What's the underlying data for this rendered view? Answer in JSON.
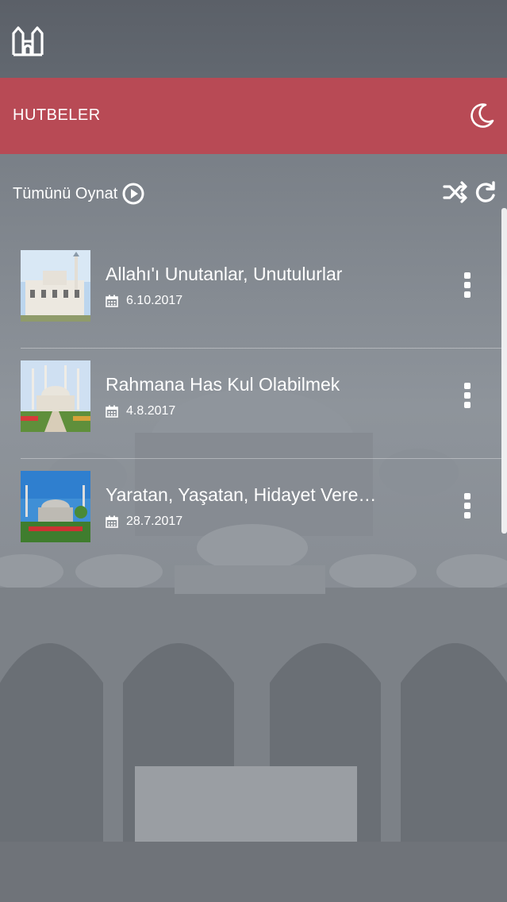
{
  "header": {
    "title": "HUTBELER"
  },
  "controls": {
    "play_all_label": "Tümünü Oynat"
  },
  "sermons": [
    {
      "title": "Allahı'ı Unutanlar, Unutulurlar",
      "date": "6.10.2017"
    },
    {
      "title": "Rahmana Has Kul Olabilmek",
      "date": "4.8.2017"
    },
    {
      "title": "Yaratan, Yaşatan, Hidayet Veren Allah",
      "date": "28.7.2017"
    }
  ],
  "colors": {
    "header_bg": "#b84a55",
    "topbar_bg": "#5e646c"
  },
  "icons": [
    "mosque-home-icon",
    "moon-icon",
    "play-circle-icon",
    "shuffle-icon",
    "repeat-icon",
    "calendar-icon",
    "more-vert-icon"
  ]
}
